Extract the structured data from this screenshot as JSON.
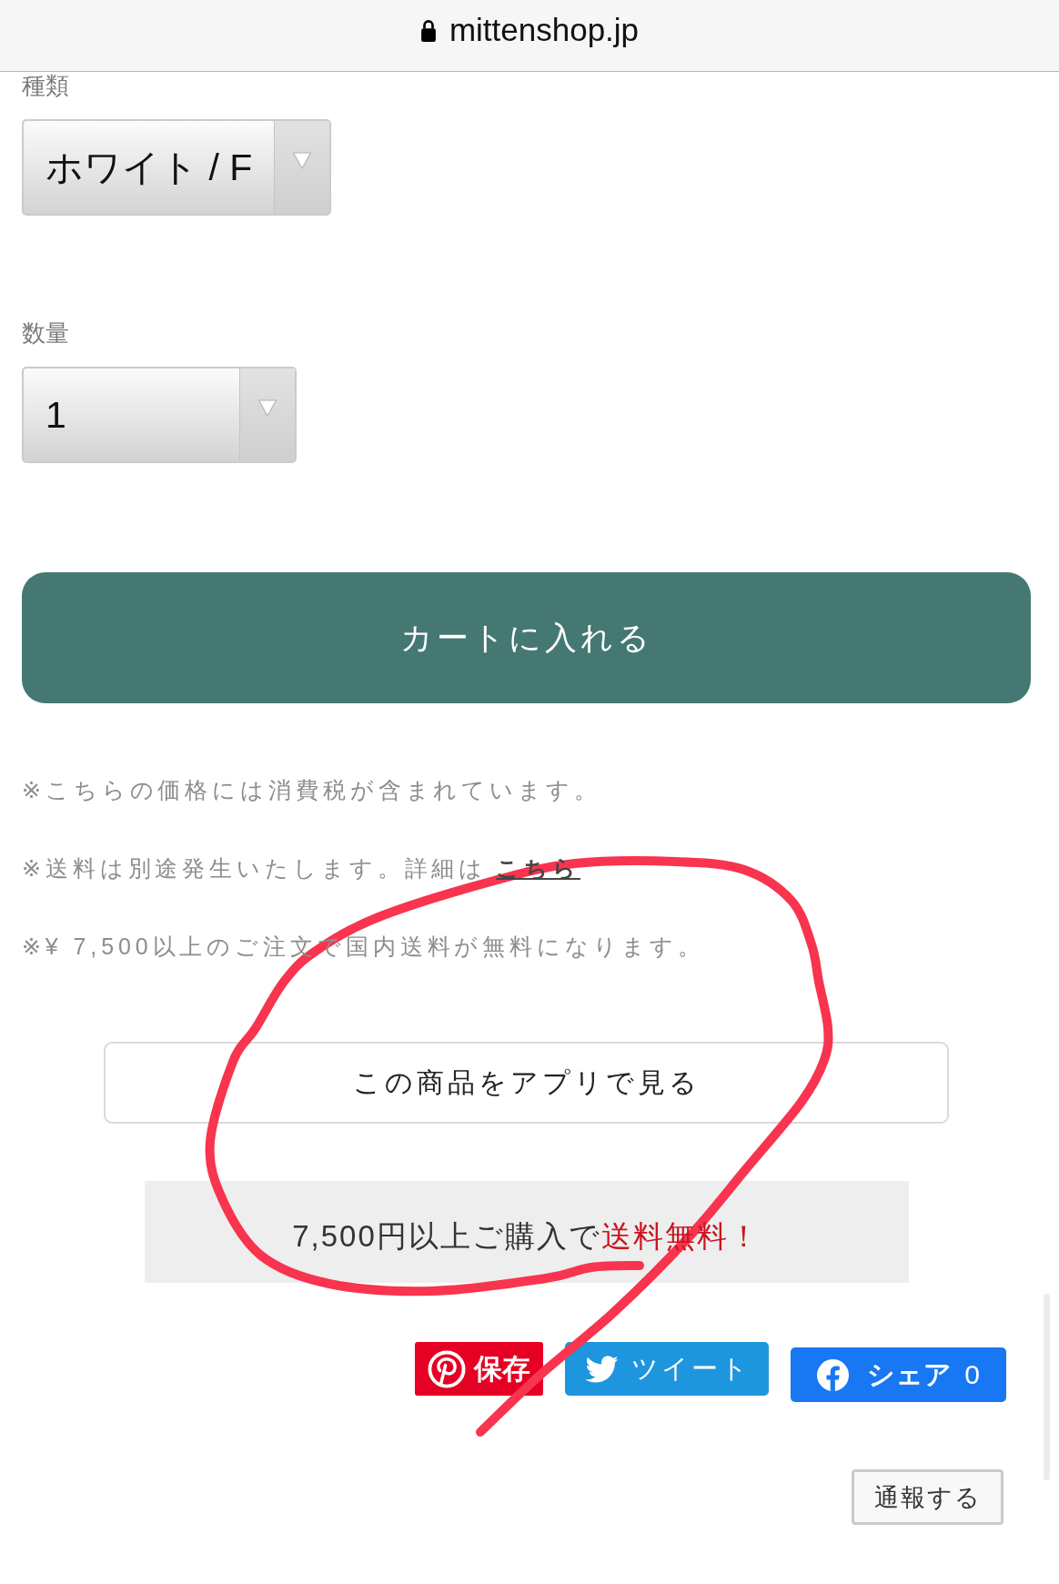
{
  "address_bar": {
    "url": "mittenshop.jp",
    "secure": true
  },
  "options": [
    {
      "label": "種類",
      "value": "ホワイト / F"
    },
    {
      "label": "数量",
      "value": "1"
    }
  ],
  "cart_button": "カートに入れる",
  "notes": [
    {
      "text": "※こちらの価格には消費税が含まれています。"
    },
    {
      "text": "※送料は別途発生いたします。詳細は",
      "link": "こちら"
    },
    {
      "text": "※¥ 7,500以上のご注文で国内送料が無料になります。"
    }
  ],
  "app_button": "この商品をアプリで見る",
  "shipping_banner": {
    "text": "7,500円以上ご購入で",
    "highlight": "送料無料！"
  },
  "share_buttons": [
    {
      "kind": "pinterest",
      "label": "保存"
    },
    {
      "kind": "twitter",
      "label": "ツイート"
    },
    {
      "kind": "facebook",
      "label": "シェア",
      "count": "0"
    }
  ],
  "report_button": "通報する"
}
